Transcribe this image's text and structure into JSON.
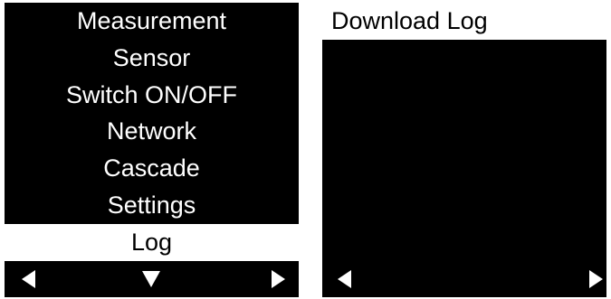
{
  "left_screen": {
    "menu_items": [
      {
        "label": "Measurement",
        "selected": false
      },
      {
        "label": "Sensor",
        "selected": false
      },
      {
        "label": "Switch ON/OFF",
        "selected": false
      },
      {
        "label": "Network",
        "selected": false
      },
      {
        "label": "Cascade",
        "selected": false
      },
      {
        "label": "Settings",
        "selected": false
      },
      {
        "label": "Log",
        "selected": true
      }
    ],
    "softkeys": {
      "left": "left-arrow-icon",
      "center": "down-arrow-icon",
      "right": "right-arrow-icon"
    }
  },
  "right_screen": {
    "header": "Download Log",
    "softkeys": {
      "left": "left-arrow-icon",
      "right": "right-arrow-icon"
    }
  },
  "colors": {
    "screen_background": "#000000",
    "text": "#ffffff",
    "highlight_background": "#ffffff",
    "highlight_text": "#000000"
  }
}
